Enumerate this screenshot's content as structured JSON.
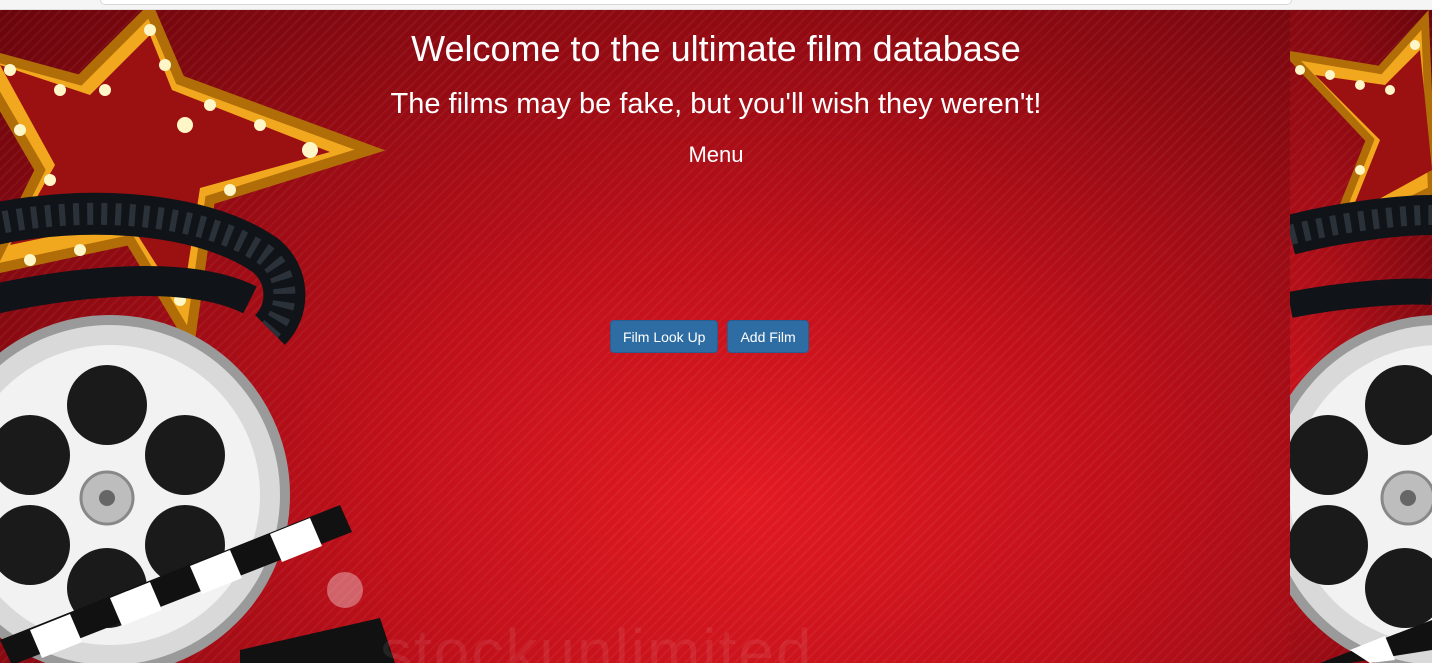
{
  "page": {
    "title": "Welcome to the ultimate film database",
    "subtitle": "The films may be fake, but you'll wish they weren't!",
    "menu_heading": "Menu"
  },
  "buttons": {
    "film_look_up": "Film Look Up",
    "add_film": "Add Film"
  },
  "background": {
    "watermark": "stockunlimited",
    "colors": {
      "red": "#c0101a",
      "dark_red": "#6a050c",
      "gold": "#f5a623",
      "button_blue": "#2e6da4"
    }
  }
}
